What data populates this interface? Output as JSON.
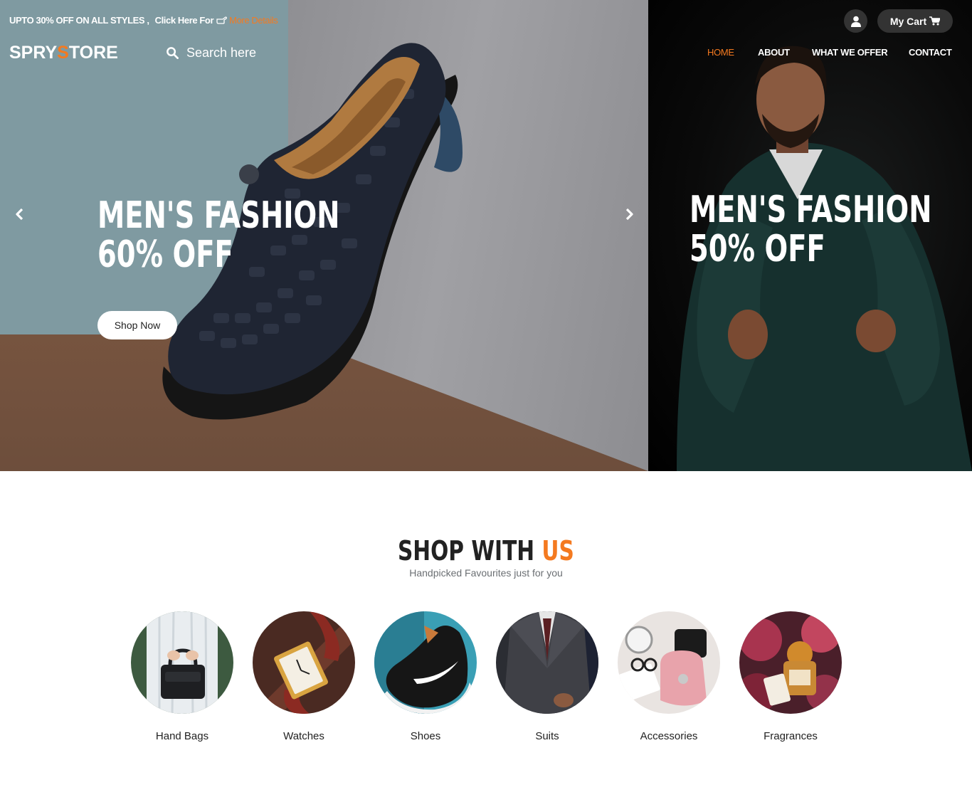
{
  "promo": {
    "text": "UPTO 30% OFF ON ALL STYLES ,",
    "click_text": "Click Here For",
    "link_text": "More Details"
  },
  "brand": {
    "logo_part1": "SPRY",
    "logo_accent": "S",
    "logo_part2": "TORE",
    "accent_color": "#f47a20"
  },
  "search": {
    "placeholder": "Search here",
    "icon": "search-icon"
  },
  "header": {
    "user_icon": "user-icon",
    "cart_label": "My Cart",
    "cart_icon": "cart-icon"
  },
  "nav": {
    "items": [
      {
        "label": "HOME",
        "active": true
      },
      {
        "label": "ABOUT",
        "active": false
      },
      {
        "label": "WHAT WE OFFER",
        "active": false
      },
      {
        "label": "CONTACT",
        "active": false
      }
    ]
  },
  "hero": {
    "slide_main": {
      "line1": "MEN'S FASHION",
      "line2": "60% OFF",
      "button": "Shop Now"
    },
    "slide_side": {
      "line1": "MEN'S FASHION",
      "line2": "50% OFF"
    },
    "prev_icon": "chevron-left-icon",
    "next_icon": "chevron-right-icon"
  },
  "shop_section": {
    "title_part1": "SHOP WITH ",
    "title_accent": "US",
    "subtitle": "Handpicked Favourites just for you",
    "categories": [
      {
        "label": "Hand Bags"
      },
      {
        "label": "Watches"
      },
      {
        "label": "Shoes"
      },
      {
        "label": "Suits"
      },
      {
        "label": "Accessories"
      },
      {
        "label": "Fragrances"
      }
    ]
  }
}
